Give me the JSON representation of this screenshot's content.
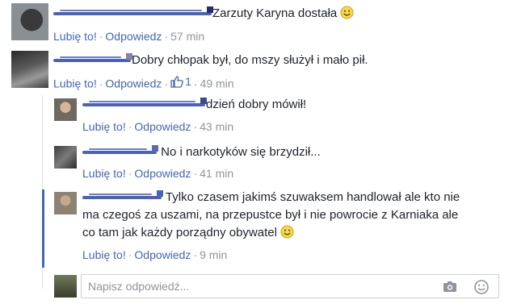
{
  "colors": {
    "link": "#4267b2",
    "meta": "#90949c",
    "text": "#1d2129",
    "thread_accent": "#4267b2"
  },
  "actions": {
    "like": "Lubię to!",
    "reply": "Odpowiedz",
    "separator": "·"
  },
  "comments": [
    {
      "text": "Zarzuty Karyna dostała",
      "emoji": "smiley-icon",
      "time": "57 min"
    },
    {
      "text": "Dobry chłopak był, do mszy służył i mało pił.",
      "likes": "1",
      "time": "49 min"
    }
  ],
  "replies": [
    {
      "text": "dzień dobry mówił!",
      "time": "43 min"
    },
    {
      "text": "No i narkotyków się brzydził...",
      "time": "41 min"
    },
    {
      "text_lines": [
        "Tylko czasem jakimś szuwaksem handlował ale kto nie",
        "ma czegoś za uszami, na przepustce był i nie powrocie z Karniaka ale",
        "co tam jak każdy porządny obywatel"
      ],
      "emoji": "smiley-icon",
      "time": "9 min"
    }
  ],
  "reply_box": {
    "placeholder": "Napisz odpowiedź..."
  }
}
